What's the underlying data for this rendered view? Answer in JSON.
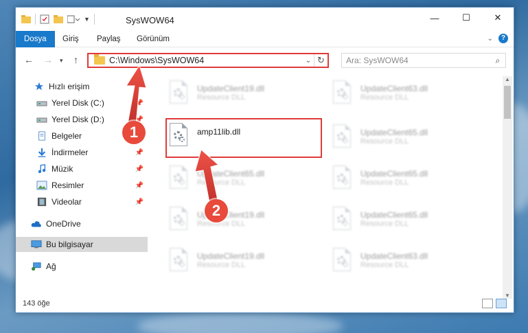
{
  "titlebar": {
    "title": "SysWOW64"
  },
  "window_controls": {
    "minimize": "—",
    "maximize": "☐",
    "close": "✕"
  },
  "ribbon": {
    "tabs": [
      {
        "label": "Dosya",
        "active": true
      },
      {
        "label": "Giriş"
      },
      {
        "label": "Paylaş"
      },
      {
        "label": "Görünüm"
      }
    ]
  },
  "navigation": {
    "address": "C:\\Windows\\SysWOW64",
    "search_placeholder": "Ara: SysWOW64"
  },
  "sidebar": {
    "items": [
      {
        "label": "Hızlı erişim",
        "icon": "star-icon"
      },
      {
        "label": "Yerel Disk (C:)",
        "icon": "drive-icon",
        "pinned": true
      },
      {
        "label": "Yerel Disk (D:)",
        "icon": "drive-icon",
        "pinned": true
      },
      {
        "label": "Belgeler",
        "icon": "documents-icon",
        "pinned": true
      },
      {
        "label": "İndirmeler",
        "icon": "downloads-icon",
        "pinned": true
      },
      {
        "label": "Müzik",
        "icon": "music-icon",
        "pinned": true
      },
      {
        "label": "Resimler",
        "icon": "pictures-icon",
        "pinned": true
      },
      {
        "label": "Videolar",
        "icon": "videos-icon",
        "pinned": true
      },
      {
        "label": "OneDrive",
        "icon": "cloud-icon"
      },
      {
        "label": "Bu bilgisayar",
        "icon": "computer-icon",
        "selected": true
      },
      {
        "label": "Ağ",
        "icon": "network-icon"
      }
    ]
  },
  "files": [
    {
      "name": "UpdateClient19.dll",
      "type": "Resource DLL"
    },
    {
      "name": "UpdateClient63.dll",
      "type": "Resource DLL"
    },
    {
      "name": "amp11lib.dll",
      "type": ""
    },
    {
      "name": "UpdateClient65.dll",
      "type": "Resource DLL"
    },
    {
      "name": "UpdateClient65.dll",
      "type": "Resource DLL"
    },
    {
      "name": "UpdateClient65.dll",
      "type": "Resource DLL"
    },
    {
      "name": "UpdateClient19.dll",
      "type": "Resource DLL"
    },
    {
      "name": "UpdateClient65.dll",
      "type": "Resource DLL"
    },
    {
      "name": "UpdateClient19.dll",
      "type": "Resource DLL"
    },
    {
      "name": "UpdateClient63.dll",
      "type": "Resource DLL"
    }
  ],
  "status": {
    "item_count": "143 öğe"
  },
  "callouts": {
    "one": "1",
    "two": "2"
  },
  "colors": {
    "accent": "#1979ca",
    "highlight": "#e03a3a",
    "callout": "#e84a3b"
  }
}
